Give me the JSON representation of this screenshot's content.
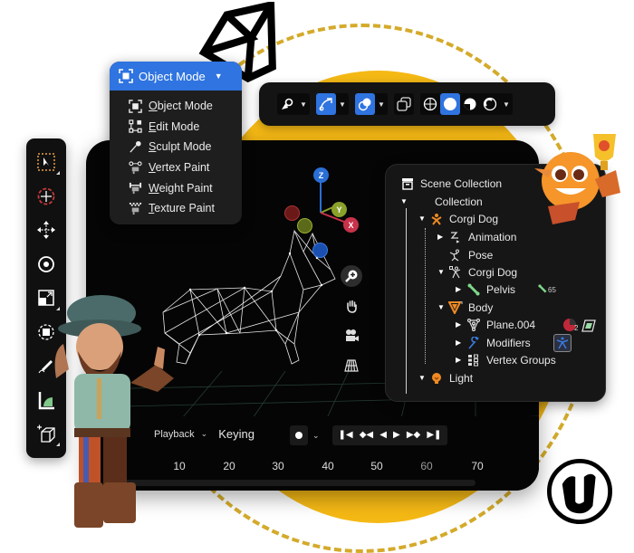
{
  "mode_menu": {
    "selected": "Object Mode",
    "items": [
      {
        "label": "Object Mode",
        "icon": "object-mode-icon"
      },
      {
        "label": "Edit Mode",
        "icon": "edit-mode-icon"
      },
      {
        "label": "Sculpt Mode",
        "icon": "sculpt-mode-icon"
      },
      {
        "label": "Vertex Paint",
        "icon": "vertex-paint-icon"
      },
      {
        "label": "Weight Paint",
        "icon": "weight-paint-icon"
      },
      {
        "label": "Texture Paint",
        "icon": "texture-paint-icon"
      }
    ]
  },
  "header_bar": {
    "buttons": [
      {
        "icon": "object-visibility-icon",
        "active": false
      },
      {
        "icon": "gizmo-icon",
        "active": true
      },
      {
        "icon": "overlay-icon",
        "active": true
      },
      {
        "icon": "xray-icon",
        "active": false
      },
      {
        "icon": "wireframe-shading-icon",
        "active": false
      },
      {
        "icon": "solid-shading-icon",
        "active": true
      },
      {
        "icon": "material-shading-icon",
        "active": false
      },
      {
        "icon": "rendered-shading-icon",
        "active": false
      }
    ]
  },
  "toolbar": {
    "tools": [
      "select-box-icon",
      "cursor-icon",
      "move-icon",
      "rotate-icon",
      "scale-icon",
      "transform-icon",
      "annotate-icon",
      "measure-icon",
      "add-cube-icon"
    ]
  },
  "gizmo": {
    "z": "Z",
    "y": "Y",
    "x": "X",
    "colors": {
      "x": "#c8324a",
      "y": "#8aa12a",
      "z": "#2a6fd6"
    }
  },
  "nav_tools": [
    "zoom-icon",
    "hand-pan-icon",
    "camera-icon",
    "grid-ortho-icon"
  ],
  "timeline": {
    "playback_label": "Playback",
    "keying_label": "Keying",
    "frames": [
      "10",
      "20",
      "30",
      "40",
      "50",
      "60",
      "70"
    ],
    "transport": [
      "jump-start-icon",
      "prev-keyframe-icon",
      "play-reverse-icon",
      "play-icon",
      "next-keyframe-icon",
      "jump-end-icon"
    ]
  },
  "outliner": {
    "rows": [
      {
        "label": "Scene Collection",
        "icon": "scene-collection-icon"
      },
      {
        "label": "Collection"
      },
      {
        "label": "Corgi Dog",
        "icon": "armature-icon"
      },
      {
        "label": "Animation",
        "icon": "animation-icon"
      },
      {
        "label": "Pose",
        "icon": "pose-icon"
      },
      {
        "label": "Corgi Dog",
        "icon": "armature-data-icon"
      },
      {
        "label": "Pelvis",
        "icon": "bone-icon",
        "badge": "65"
      },
      {
        "label": "Body",
        "icon": "mesh-object-icon"
      },
      {
        "label": "Plane.004",
        "icon": "mesh-data-icon",
        "badge": "2"
      },
      {
        "label": "Modifiers",
        "icon": "wrench-icon"
      },
      {
        "label": "Vertex Groups",
        "icon": "vertex-groups-icon"
      },
      {
        "label": "Light",
        "icon": "light-icon"
      }
    ]
  },
  "colors": {
    "accent_blue": "#2f74e0",
    "brand_yellow": "#f5b915",
    "outliner_orange": "#f08a24",
    "bone_green": "#7fd88a"
  }
}
